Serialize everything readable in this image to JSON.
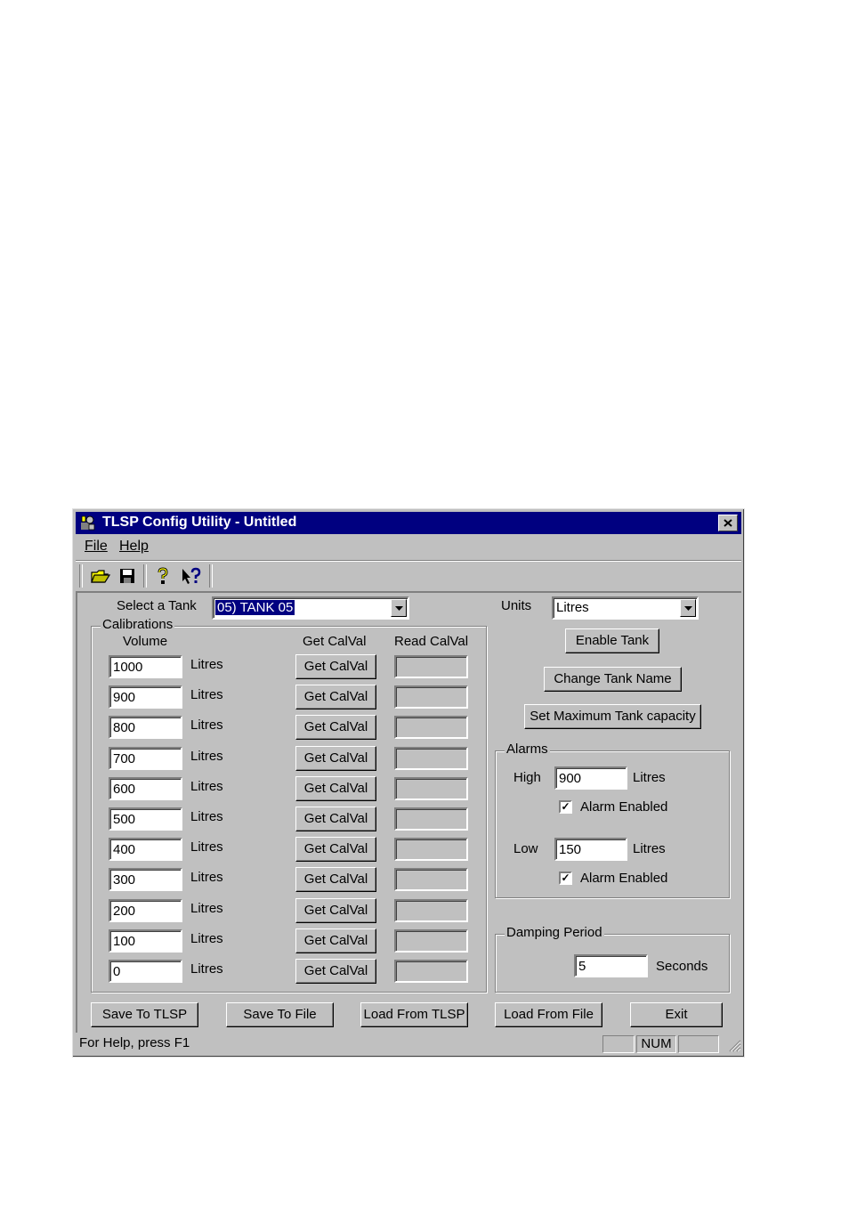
{
  "window": {
    "title": "TLSP Config Utility - Untitled"
  },
  "menu": {
    "file": "File",
    "help": "Help"
  },
  "toolbar": {
    "icons": [
      "open-folder-icon",
      "save-disk-icon",
      "help-question-icon",
      "context-help-icon"
    ]
  },
  "tank_select": {
    "label": "Select a Tank",
    "value": "05) TANK 05"
  },
  "units": {
    "label": "Units",
    "value": "Litres"
  },
  "calibrations": {
    "group_title": "Calibrations",
    "col_volume": "Volume",
    "col_get": "Get CalVal",
    "col_read": "Read CalVal",
    "unit": "Litres",
    "button_label": "Get CalVal",
    "rows": [
      "1000",
      "900",
      "800",
      "700",
      "600",
      "500",
      "400",
      "300",
      "200",
      "100",
      "0"
    ]
  },
  "buttons": {
    "enable_tank": "Enable Tank",
    "change_name": "Change Tank Name",
    "set_max": "Set Maximum Tank capacity",
    "save_tlsp": "Save To TLSP",
    "save_file": "Save To File",
    "load_tlsp": "Load From TLSP",
    "load_file": "Load From File",
    "exit": "Exit"
  },
  "alarms": {
    "group_title": "Alarms",
    "high_label": "High",
    "high_value": "900",
    "high_unit": "Litres",
    "high_enabled_label": "Alarm Enabled",
    "high_enabled": true,
    "low_label": "Low",
    "low_value": "150",
    "low_unit": "Litres",
    "low_enabled_label": "Alarm Enabled",
    "low_enabled": true
  },
  "damping": {
    "group_title": "Damping Period",
    "value": "5",
    "unit": "Seconds"
  },
  "status": {
    "help": "For Help, press F1",
    "num": "NUM"
  }
}
